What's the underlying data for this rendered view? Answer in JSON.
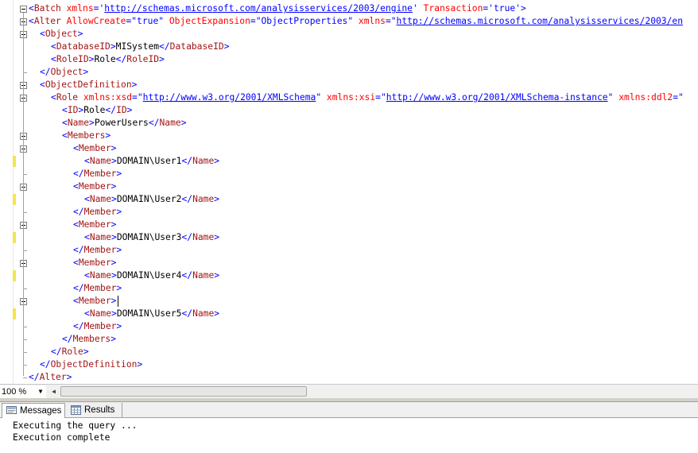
{
  "editor": {
    "lines": [
      {
        "tok": [
          [
            "b",
            "<"
          ],
          [
            "m",
            "Batch"
          ],
          [
            "a",
            " xmlns"
          ],
          [
            "b",
            "='"
          ],
          [
            "u",
            "http://schemas.microsoft.com/analysisservices/2003/engine"
          ],
          [
            "b",
            "'"
          ],
          [
            "a",
            " Transaction"
          ],
          [
            "b",
            "='true'>"
          ]
        ]
      },
      {
        "tok": [
          [
            "b",
            "<"
          ],
          [
            "m",
            "Alter"
          ],
          [
            "a",
            " AllowCreate"
          ],
          [
            "b",
            "=\"true\""
          ],
          [
            "a",
            " ObjectExpansion"
          ],
          [
            "b",
            "=\"ObjectProperties\""
          ],
          [
            "a",
            " xmlns"
          ],
          [
            "b",
            "=\""
          ],
          [
            "u",
            "http://schemas.microsoft.com/analysisservices/2003/en"
          ]
        ]
      },
      {
        "tok": [
          [
            "b",
            "<"
          ],
          [
            "m",
            "Object"
          ],
          [
            "b",
            ">"
          ]
        ]
      },
      {
        "tok": [
          [
            "b",
            "<"
          ],
          [
            "m",
            "DatabaseID"
          ],
          [
            "b",
            ">"
          ],
          [
            "t",
            "MISystem"
          ],
          [
            "b",
            "</"
          ],
          [
            "m",
            "DatabaseID"
          ],
          [
            "b",
            ">"
          ]
        ]
      },
      {
        "tok": [
          [
            "b",
            "<"
          ],
          [
            "m",
            "RoleID"
          ],
          [
            "b",
            ">"
          ],
          [
            "t",
            "Role"
          ],
          [
            "b",
            "</"
          ],
          [
            "m",
            "RoleID"
          ],
          [
            "b",
            ">"
          ]
        ]
      },
      {
        "tok": [
          [
            "b",
            "</"
          ],
          [
            "m",
            "Object"
          ],
          [
            "b",
            ">"
          ]
        ]
      },
      {
        "tok": [
          [
            "b",
            "<"
          ],
          [
            "m",
            "ObjectDefinition"
          ],
          [
            "b",
            ">"
          ]
        ]
      },
      {
        "tok": [
          [
            "b",
            "<"
          ],
          [
            "m",
            "Role"
          ],
          [
            "a",
            " xmlns:xsd"
          ],
          [
            "b",
            "=\""
          ],
          [
            "u",
            "http://www.w3.org/2001/XMLSchema"
          ],
          [
            "b",
            "\""
          ],
          [
            "a",
            " xmlns:xsi"
          ],
          [
            "b",
            "=\""
          ],
          [
            "u",
            "http://www.w3.org/2001/XMLSchema-instance"
          ],
          [
            "b",
            "\""
          ],
          [
            "a",
            " xmlns:ddl2"
          ],
          [
            "b",
            "=\""
          ]
        ]
      },
      {
        "tok": [
          [
            "b",
            "<"
          ],
          [
            "m",
            "ID"
          ],
          [
            "b",
            ">"
          ],
          [
            "t",
            "Role"
          ],
          [
            "b",
            "</"
          ],
          [
            "m",
            "ID"
          ],
          [
            "b",
            ">"
          ]
        ]
      },
      {
        "tok": [
          [
            "b",
            "<"
          ],
          [
            "m",
            "Name"
          ],
          [
            "b",
            ">"
          ],
          [
            "t",
            "PowerUsers"
          ],
          [
            "b",
            "</"
          ],
          [
            "m",
            "Name"
          ],
          [
            "b",
            ">"
          ]
        ]
      },
      {
        "tok": [
          [
            "b",
            "<"
          ],
          [
            "m",
            "Members"
          ],
          [
            "b",
            ">"
          ]
        ]
      },
      {
        "tok": [
          [
            "b",
            "<"
          ],
          [
            "m",
            "Member"
          ],
          [
            "b",
            ">"
          ]
        ]
      },
      {
        "tok": [
          [
            "b",
            "<"
          ],
          [
            "m",
            "Name"
          ],
          [
            "b",
            ">"
          ],
          [
            "t",
            "DOMAIN\\User1"
          ],
          [
            "b",
            "</"
          ],
          [
            "m",
            "Name"
          ],
          [
            "b",
            ">"
          ]
        ]
      },
      {
        "tok": [
          [
            "b",
            "</"
          ],
          [
            "m",
            "Member"
          ],
          [
            "b",
            ">"
          ]
        ]
      },
      {
        "tok": [
          [
            "b",
            "<"
          ],
          [
            "m",
            "Member"
          ],
          [
            "b",
            ">"
          ]
        ]
      },
      {
        "tok": [
          [
            "b",
            "<"
          ],
          [
            "m",
            "Name"
          ],
          [
            "b",
            ">"
          ],
          [
            "t",
            "DOMAIN\\User2"
          ],
          [
            "b",
            "</"
          ],
          [
            "m",
            "Name"
          ],
          [
            "b",
            ">"
          ]
        ]
      },
      {
        "tok": [
          [
            "b",
            "</"
          ],
          [
            "m",
            "Member"
          ],
          [
            "b",
            ">"
          ]
        ]
      },
      {
        "tok": [
          [
            "b",
            "<"
          ],
          [
            "m",
            "Member"
          ],
          [
            "b",
            ">"
          ]
        ]
      },
      {
        "tok": [
          [
            "b",
            "<"
          ],
          [
            "m",
            "Name"
          ],
          [
            "b",
            ">"
          ],
          [
            "t",
            "DOMAIN\\User3"
          ],
          [
            "b",
            "</"
          ],
          [
            "m",
            "Name"
          ],
          [
            "b",
            ">"
          ]
        ]
      },
      {
        "tok": [
          [
            "b",
            "</"
          ],
          [
            "m",
            "Member"
          ],
          [
            "b",
            ">"
          ]
        ]
      },
      {
        "tok": [
          [
            "b",
            "<"
          ],
          [
            "m",
            "Member"
          ],
          [
            "b",
            ">"
          ]
        ]
      },
      {
        "tok": [
          [
            "b",
            "<"
          ],
          [
            "m",
            "Name"
          ],
          [
            "b",
            ">"
          ],
          [
            "t",
            "DOMAIN\\User4"
          ],
          [
            "b",
            "</"
          ],
          [
            "m",
            "Name"
          ],
          [
            "b",
            ">"
          ]
        ]
      },
      {
        "tok": [
          [
            "b",
            "</"
          ],
          [
            "m",
            "Member"
          ],
          [
            "b",
            ">"
          ]
        ]
      },
      {
        "tok": [
          [
            "b",
            "<"
          ],
          [
            "m",
            "Member"
          ],
          [
            "b",
            ">"
          ]
        ]
      },
      {
        "tok": [
          [
            "b",
            "<"
          ],
          [
            "m",
            "Name"
          ],
          [
            "b",
            ">"
          ],
          [
            "t",
            "DOMAIN\\User5"
          ],
          [
            "b",
            "</"
          ],
          [
            "m",
            "Name"
          ],
          [
            "b",
            ">"
          ]
        ]
      },
      {
        "tok": [
          [
            "b",
            "</"
          ],
          [
            "m",
            "Member"
          ],
          [
            "b",
            ">"
          ]
        ]
      },
      {
        "tok": [
          [
            "b",
            "</"
          ],
          [
            "m",
            "Members"
          ],
          [
            "b",
            ">"
          ]
        ]
      },
      {
        "tok": [
          [
            "b",
            "</"
          ],
          [
            "m",
            "Role"
          ],
          [
            "b",
            ">"
          ]
        ]
      },
      {
        "tok": [
          [
            "b",
            "</"
          ],
          [
            "m",
            "ObjectDefinition"
          ],
          [
            "b",
            ">"
          ]
        ]
      },
      {
        "tok": [
          [
            "b",
            "</"
          ],
          [
            "m",
            "Alter"
          ],
          [
            "b",
            ">"
          ]
        ]
      }
    ]
  },
  "toolbar": {
    "zoom": "100 %"
  },
  "results_tabs": [
    {
      "label": "Messages",
      "icon": "messages-icon"
    },
    {
      "label": "Results",
      "icon": "grid-icon"
    }
  ],
  "output": {
    "lines": [
      "Executing the query ...",
      "Execution complete"
    ]
  },
  "colors": {
    "tag_bracket": "#0000ff",
    "element_name": "#a31515",
    "attribute": "#ff0000",
    "change_marker": "#f2e64e"
  }
}
